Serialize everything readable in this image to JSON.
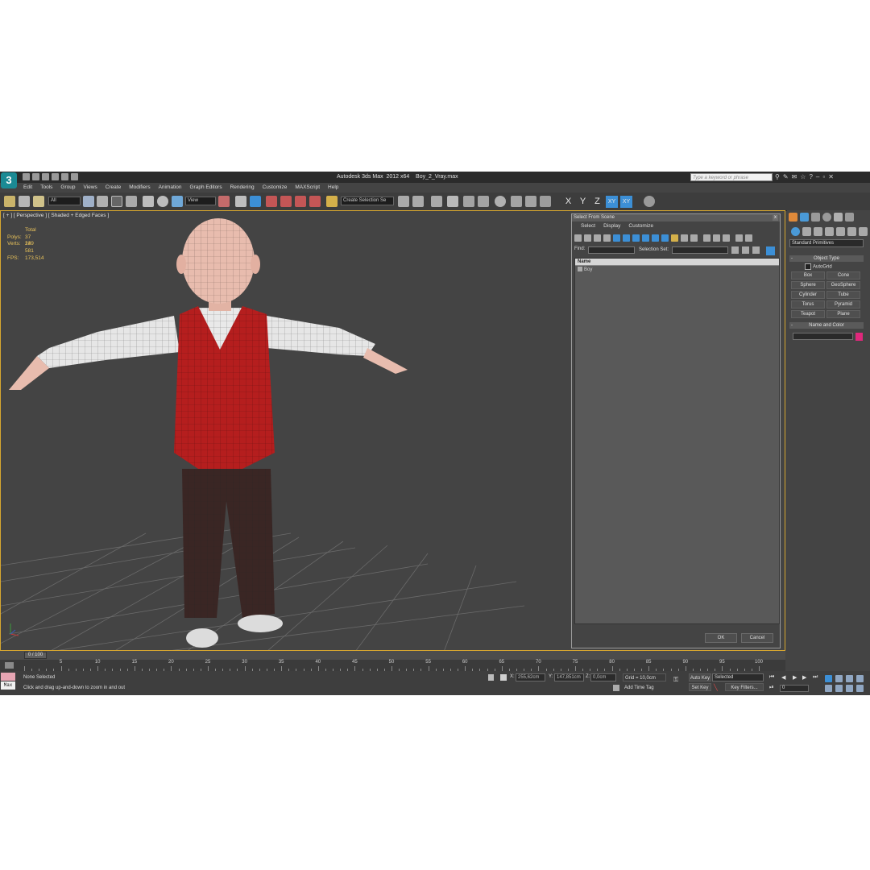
{
  "window": {
    "title": "Autodesk 3ds Max  2012 x64    Boy_2_Vray.max",
    "search_placeholder": "Type a keyword or phrase",
    "logo_glyph": "3"
  },
  "menu": [
    "Edit",
    "Tools",
    "Group",
    "Views",
    "Create",
    "Modifiers",
    "Animation",
    "Graph Editors",
    "Rendering",
    "Customize",
    "MAXScript",
    "Help"
  ],
  "toolbar": {
    "selection_filter": "All",
    "ref_coord": "View",
    "named_selection": "Create Selection Se",
    "axis_x": "X",
    "axis_y": "Y",
    "axis_z": "Z",
    "axis_xy": "XY",
    "axis_xy2": "XY"
  },
  "viewport": {
    "label": "[ + ] [ Perspective ] [ Shaded + Edged Faces ]",
    "stats": {
      "total_label": "Total",
      "polys_label": "Polys:",
      "polys_value": "37 149",
      "verts_label": "Verts:",
      "verts_value": "23 581",
      "fps_label": "FPS:",
      "fps_value": "173,514"
    }
  },
  "dialog": {
    "title": "Select From Scene",
    "close": "x",
    "menu": [
      "Select",
      "Display",
      "Customize"
    ],
    "find_label": "Find:",
    "selection_set_label": "Selection Set:",
    "column_name": "Name",
    "rows": [
      "Boy"
    ],
    "ok": "OK",
    "cancel": "Cancel"
  },
  "command_panel": {
    "dropdown": "Standard Primitives",
    "object_type_header": "Object Type",
    "autogrid": "AutoGrid",
    "primitives": [
      "Box",
      "Cone",
      "Sphere",
      "GeoSphere",
      "Cylinder",
      "Tube",
      "Torus",
      "Pyramid",
      "Teapot",
      "Plane"
    ],
    "name_color_header": "Name and Color",
    "collapse_glyph": "-",
    "object_color": "#e0287c"
  },
  "timeline": {
    "frame_indicator": "0 / 100",
    "ticks": [
      "0",
      "5",
      "10",
      "15",
      "20",
      "25",
      "30",
      "35",
      "40",
      "45",
      "50",
      "55",
      "60",
      "65",
      "70",
      "75",
      "80",
      "85",
      "90",
      "95",
      "100"
    ]
  },
  "status": {
    "selection": "None Selected",
    "prompt": "Click and drag up-and-down to zoom in and out",
    "max_label": "Max",
    "x_label": "X:",
    "x_value": "255,62cm",
    "y_label": "Y:",
    "y_value": "147,851cm",
    "z_label": "Z:",
    "z_value": "0,0cm",
    "grid": "Grid = 10,0cm",
    "add_time_tag": "Add Time Tag",
    "auto_key": "Auto Key",
    "set_key": "Set Key",
    "key_mode": "Selected",
    "key_filters": "Key Filters...",
    "current_frame": "0"
  }
}
